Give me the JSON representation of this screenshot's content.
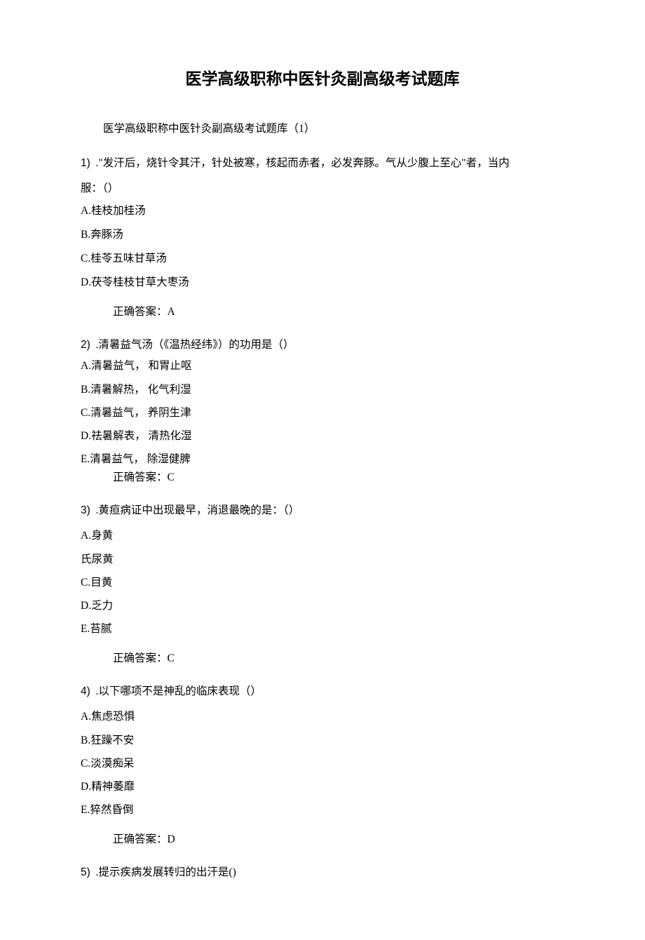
{
  "title": "医学高级职称中医针灸副高级考试题库",
  "intro": "医学高级职称中医针灸副高级考试题库（1）",
  "q1": {
    "num": "1)",
    "text_line1": ".\"发汗后，烧针令其汗，针处被寒，核起而赤者，必发奔豚。气从少腹上至心\"者，当内",
    "text_line2": "服：（）",
    "optA": "A.桂枝加桂汤",
    "optB": "B.奔豚汤",
    "optC": "C.桂苓五味甘草汤",
    "optD": "D.茯苓桂枝甘草大枣汤",
    "answer": "正确答案：A"
  },
  "q2": {
    "num": "2)",
    "text": ".清暑益气汤（《温热经纬》）的功用是（）",
    "optA": "A.清暑益气， 和胃止呕",
    "optB": "B.清暑解热， 化气利湿",
    "optC": "C.清暑益气， 养阴生津",
    "optD": "D.祛暑解表， 清热化湿",
    "optE": "E.清暑益气， 除湿健脾",
    "answer": "正确答案：C"
  },
  "q3": {
    "num": "3)",
    "text": ".黄疸病证中出现最早，消退最晚的是：（）",
    "optA": "A.身黄",
    "optB": "氏尿黄",
    "optC": "C.目黄",
    "optD": "D.乏力",
    "optE": "E.苔腻",
    "answer": "正确答案：C"
  },
  "q4": {
    "num": "4)",
    "text": ".以下哪项不是神乱的临床表现（）",
    "optA": "A.焦虑恐惧",
    "optB": "B.狂躁不安",
    "optC": "C.淡漠痴呆",
    "optD": "D.精神萎靡",
    "optE": "E.猝然昏倒",
    "answer": "正确答案：D"
  },
  "q5": {
    "num": "5)",
    "text": ".提示疾病发展转归的出汗是()"
  }
}
